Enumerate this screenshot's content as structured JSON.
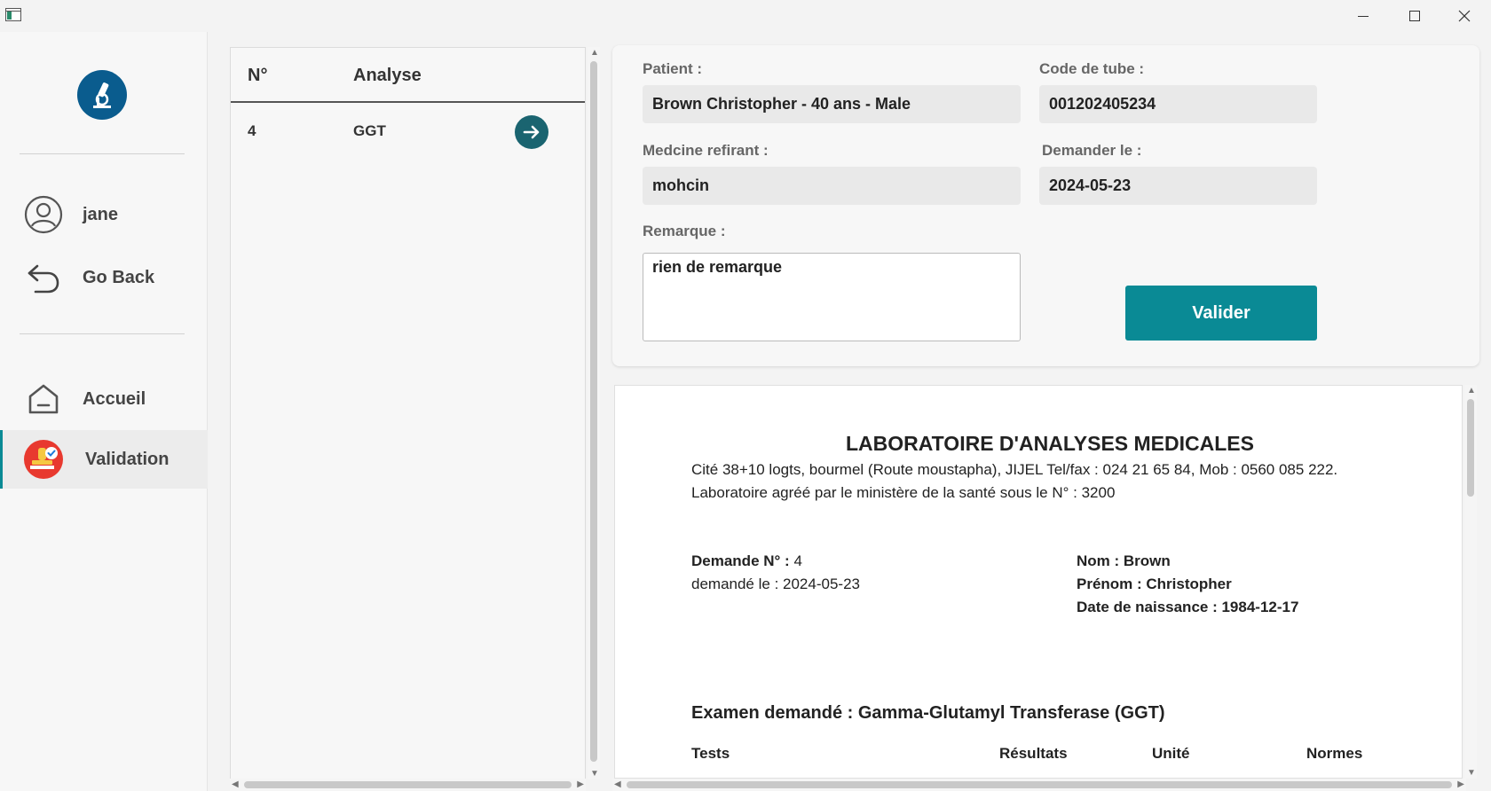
{
  "window": {
    "minimize_icon": "minimize-icon",
    "maximize_icon": "maximize-icon",
    "close_icon": "close-icon"
  },
  "sidebar": {
    "logo_icon": "microscope-icon",
    "user": {
      "icon": "user-circle-icon",
      "label": "jane"
    },
    "back": {
      "icon": "undo-arrow-icon",
      "label": "Go Back"
    },
    "items": [
      {
        "icon": "home-icon",
        "label": "Accueil"
      },
      {
        "icon": "stamp-check-icon",
        "label": "Validation",
        "active": true
      }
    ]
  },
  "list": {
    "headers": {
      "num": "N°",
      "analyse": "Analyse"
    },
    "rows": [
      {
        "num": "4",
        "analyse": "GGT"
      }
    ]
  },
  "form": {
    "patient_label": "Patient :",
    "patient_value": "Brown Christopher - 40 ans - Male",
    "tube_label": "Code de tube :",
    "tube_value": "001202405234",
    "medecin_label": "Medcine refirant :",
    "medecin_value": "mohcin",
    "date_label": "Demander le :",
    "date_value": "2024-05-23",
    "remarque_label": "Remarque :",
    "remarque_value": "rien de remarque",
    "valider_label": "Valider"
  },
  "document": {
    "title": "LABORATOIRE D'ANALYSES MEDICALES",
    "address": "Cité 38+10 logts, bourmel (Route moustapha), JIJEL Tel/fax : 024 21 65 84, Mob : 0560 085 222.",
    "agreement": "Laboratoire agréé par le ministère de la santé sous le N° : 3200",
    "demande_label": "Demande N° :",
    "demande_value": " 4",
    "demande_date": "demandé le : 2024-05-23",
    "nom": "Nom : Brown",
    "prenom": "Prénom : Christopher",
    "naissance": "Date de naissance : 1984-12-17",
    "examen": "Examen demandé : Gamma-Glutamyl Transferase (GGT)",
    "table_headers": {
      "tests": "Tests",
      "resultats": "Résultats",
      "unite": "Unité",
      "normes": "Normes"
    }
  },
  "colors": {
    "accent": "#0a8a95",
    "logo_bg": "#0a5c8e",
    "go_button": "#1a6470",
    "stamp": "#e8392f"
  }
}
